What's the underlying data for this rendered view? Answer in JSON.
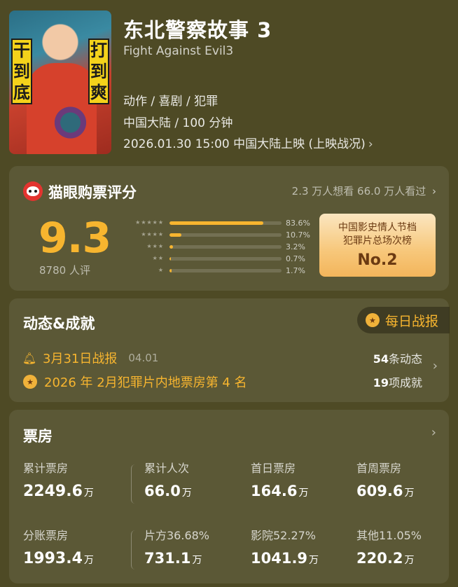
{
  "movie": {
    "title": "东北警察故事 3",
    "subtitle": "Fight Against Evil3",
    "genres": "动作 / 喜剧 / 犯罪",
    "region_duration": "中国大陆 / 100 分钟",
    "release": "2026.01.30 15:00 中国大陆上映 (上映战况)",
    "poster_text_left": "干到底",
    "poster_text_right": "打到爽"
  },
  "rating": {
    "title": "猫眼购票评分",
    "want_watch": "2.3 万人想看 66.0 万人看过",
    "score": "9.3",
    "count": "8780 人评",
    "distribution": [
      {
        "stars": "★★★★★",
        "percent": 83.6,
        "label": "83.6%"
      },
      {
        "stars": "★★★★",
        "percent": 10.7,
        "label": "10.7%"
      },
      {
        "stars": "★★★",
        "percent": 3.2,
        "label": "3.2%"
      },
      {
        "stars": "★★",
        "percent": 0.7,
        "label": "0.7%"
      },
      {
        "stars": "★",
        "percent": 1.7,
        "label": "1.7%"
      }
    ],
    "rank_line1": "中国影史情人节档",
    "rank_line2": "犯罪片总场次榜",
    "rank_no": "No.2"
  },
  "dynamics": {
    "title": "动态&成就",
    "daily_report": "每日战报",
    "row1_text": "3月31日战报",
    "row1_date": "04.01",
    "row2_text": "2026 年 2月犯罪片内地票房第 4 名",
    "count1_num": "54",
    "count1_label": "条动态",
    "count2_num": "19",
    "count2_label": "项成就"
  },
  "box_office": {
    "title": "票房",
    "row1": [
      {
        "label": "累计票房",
        "value": "2249.6",
        "unit": "万"
      },
      {
        "label": "累计人次",
        "value": "66.0",
        "unit": "万"
      },
      {
        "label": "首日票房",
        "value": "164.6",
        "unit": "万"
      },
      {
        "label": "首周票房",
        "value": "609.6",
        "unit": "万"
      }
    ],
    "row2": [
      {
        "label": "分账票房",
        "value": "1993.4",
        "unit": "万"
      },
      {
        "label": "片方36.68%",
        "value": "731.1",
        "unit": "万"
      },
      {
        "label": "影院52.27%",
        "value": "1041.9",
        "unit": "万"
      },
      {
        "label": "其他11.05%",
        "value": "220.2",
        "unit": "万"
      }
    ]
  },
  "colors": {
    "accent": "#f7b52f",
    "background": "#4e4a25"
  }
}
